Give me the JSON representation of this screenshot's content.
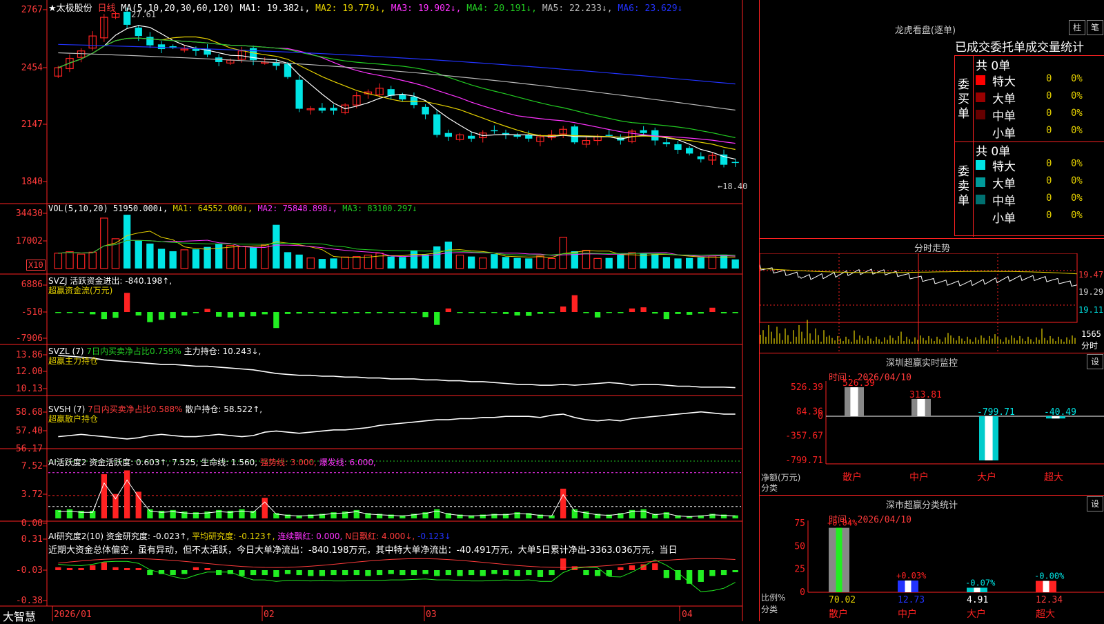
{
  "header": {
    "stock_name": "★太极股份",
    "period": "日线",
    "ma_label": "MA(5,10,20,30,60,120)",
    "ma1": "MA1: 19.382↓,",
    "ma2": "MA2: 19.779↓,",
    "ma3": "MA3: 19.902↓,",
    "ma4": "MA4: 20.191↓,",
    "ma5": "MA5: 22.233↓,",
    "ma6": "MA6: 23.629↓",
    "high_mark": "27.61",
    "low_mark": "←18.40"
  },
  "price_axis": [
    "2767",
    "2454",
    "2147",
    "1840"
  ],
  "vol": {
    "label": "VOL(5,10,20) 51950.000↓,",
    "ma1": "MA1: 64552.000↓,",
    "ma2": "MA2: 75848.898↓,",
    "ma3": "MA3: 83100.297↓",
    "axis": [
      "34430",
      "17002"
    ],
    "unit": "X10"
  },
  "svzj": {
    "label": "SVZJ  活跃资金进出: -840.198↑,",
    "sub": "超赢资金流(万元)",
    "axis": [
      "6886",
      "-510",
      "-7906"
    ]
  },
  "svzl": {
    "label": "SVZL (7)",
    "ratio": "7日内买卖净占比0.759%",
    "hold": "主力持仓: 10.243↓,",
    "sub": "超赢主力持仓",
    "axis": [
      "13.86",
      "12.00",
      "10.13"
    ]
  },
  "svsh": {
    "label": "SVSH (7)",
    "ratio": "7日内买卖净占比0.588%",
    "hold": "散户持仓: 58.522↑,",
    "sub": "超赢散户持仓",
    "axis": [
      "58.68",
      "57.40",
      "56.17"
    ]
  },
  "ai": {
    "label": "AI活跃度2 资金活跃度: 0.603↑, 7.525, 生命线: 1.560,",
    "strong": "强势线: 3.000,",
    "burst": "爆发线: 6.000,",
    "axis": [
      "7.52",
      "3.72",
      "0.00"
    ]
  },
  "research": {
    "label": "AI研究度2(10) 资金研究度: -0.023↑,",
    "avg": "平均研究度: -0.123↑,",
    "cont": "连续飘红: 0.000,",
    "nday": "N日飘红: 4.000↓,",
    "last": "-0.123↓",
    "summary": "近期大资金总体偏空，虽有异动，但不太活跃，今日大单净流出：-840.198万元，其中特大单净流出：-40.491万元，大单5日累计净出-3363.036万元，当日",
    "axis": [
      "0.31",
      "-0.03",
      "-0.38"
    ]
  },
  "xaxis": {
    "brand": "大智慧",
    "dates": [
      "2026/01",
      "02",
      "03",
      "04"
    ]
  },
  "dragon": {
    "title": "龙虎看盘(逐单)",
    "tab1": "柱",
    "tab2": "笔",
    "subtitle": "已成交委托单成交量统计",
    "buy_label": "委买单",
    "sell_label": "委卖单",
    "buy_total": "共 0单",
    "sell_total": "共 0单",
    "buy_rows": [
      {
        "name": "特大",
        "val": "0",
        "pct": "0%",
        "color": "#ff0000"
      },
      {
        "name": "大单",
        "val": "0",
        "pct": "0%",
        "color": "#990000"
      },
      {
        "name": "中单",
        "val": "0",
        "pct": "0%",
        "color": "#660000"
      },
      {
        "name": "小单",
        "val": "0",
        "pct": "0%",
        "color": ""
      }
    ],
    "sell_rows": [
      {
        "name": "特大",
        "val": "0",
        "pct": "0%",
        "color": "#00e5e5"
      },
      {
        "name": "大单",
        "val": "0",
        "pct": "0%",
        "color": "#009a9a"
      },
      {
        "name": "中单",
        "val": "0",
        "pct": "0%",
        "color": "#007070"
      },
      {
        "name": "小单",
        "val": "0",
        "pct": "0%",
        "color": ""
      }
    ]
  },
  "intraday": {
    "title": "分时走势",
    "axis": [
      "19.47",
      "19.29",
      "19.11"
    ],
    "vol": "1565",
    "vol_unit": "分时"
  },
  "monitor": {
    "title": "深圳超赢实时监控",
    "set": "设",
    "time": "时间: 2026/04/10",
    "axis": [
      "526.39",
      "84.36",
      "0",
      "-357.67",
      "-799.71"
    ],
    "ylabel": "净额(万元)",
    "xlabel": "分类",
    "bars": [
      {
        "name": "散户",
        "value": 526.39,
        "label": "526.39"
      },
      {
        "name": "中户",
        "value": 313.81,
        "label": "313.81"
      },
      {
        "name": "大户",
        "value": -799.71,
        "label": "-799.71"
      },
      {
        "name": "超大",
        "value": -40.49,
        "label": "-40.49"
      }
    ]
  },
  "stats": {
    "title": "深市超赢分类统计",
    "set": "设",
    "time": "时间: 2026/04/10",
    "axis": [
      "75",
      "50",
      "25",
      "0"
    ],
    "ylabel": "比例%",
    "xlabel": "分类",
    "bars": [
      {
        "name": "散户",
        "value": 70.02,
        "label": "70.02",
        "change": "+0.04%"
      },
      {
        "name": "中户",
        "value": 12.73,
        "label": "12.73",
        "change": "+0.03%"
      },
      {
        "name": "大户",
        "value": 4.91,
        "label": "4.91",
        "change": "-0.07%"
      },
      {
        "name": "超大",
        "value": 12.34,
        "label": "12.34",
        "change": "-0.00%"
      }
    ]
  },
  "chart_data": [
    {
      "type": "candlestick",
      "xlabel": "",
      "ylabel": "",
      "ylim": [
        18.4,
        27.61
      ],
      "x_ticks": [
        "2026/01",
        "02",
        "03",
        "04"
      ],
      "close": [
        24.5,
        25.0,
        25.4,
        26.2,
        27.2,
        27.4,
        26.8,
        26.2,
        25.7,
        25.5,
        25.6,
        25.5,
        25.4,
        25.2,
        24.8,
        24.9,
        25.4,
        24.9,
        24.8,
        24.6,
        24.0,
        22.3,
        22.3,
        22.2,
        22.2,
        22.5,
        23.0,
        23.2,
        23.4,
        23.0,
        22.8,
        22.5,
        22.0,
        20.9,
        20.8,
        20.9,
        20.7,
        21.0,
        21.1,
        20.9,
        20.8,
        20.7,
        20.8,
        20.9,
        21.2,
        20.5,
        20.6,
        20.8,
        20.9,
        20.6,
        21.1,
        21.0,
        20.6,
        20.4,
        20.1,
        19.9,
        19.6,
        19.8,
        19.3,
        19.4
      ],
      "ma_series": [
        {
          "name": "MA1",
          "color": "#ffffff"
        },
        {
          "name": "MA2",
          "color": "#e6d200"
        },
        {
          "name": "MA3",
          "color": "#ff33ff"
        },
        {
          "name": "MA4",
          "color": "#22cc22"
        },
        {
          "name": "MA5",
          "color": "#bbbbbb"
        },
        {
          "name": "MA6",
          "color": "#2233ff"
        }
      ]
    },
    {
      "type": "bar",
      "title": "VOL",
      "values": [
        3.2,
        3.5,
        3.0,
        3.4,
        10.5,
        6.2,
        11.2,
        5.8,
        5.2,
        4.1,
        3.6,
        3.9,
        4.0,
        4.5,
        5.1,
        4.8,
        4.6,
        4.4,
        4.9,
        9.1,
        3.4,
        2.9,
        2.2,
        2.0,
        2.1,
        2.4,
        2.5,
        2.8,
        3.2,
        2.5,
        2.4,
        3.8,
        2.9,
        4.6,
        5.6,
        2.8,
        2.5,
        2.2,
        3.0,
        2.4,
        2.2,
        2.1,
        2.6,
        2.1,
        6.5,
        3.6,
        3.8,
        2.1,
        2.2,
        2.9,
        3.3,
        3.2,
        3.0,
        2.4,
        2.1,
        2.2,
        2.3,
        2.6,
        2.9,
        1.9
      ]
    },
    {
      "type": "bar",
      "title": "超赢资金流",
      "values": [
        -200,
        -150,
        -250,
        -600,
        -1800,
        -1500,
        4900,
        -900,
        -2600,
        -2000,
        -1600,
        -900,
        -300,
        800,
        -1200,
        -1400,
        -1200,
        -1100,
        -600,
        -4100,
        -500,
        -400,
        -300,
        -200,
        -400,
        -300,
        -300,
        -350,
        -300,
        -250,
        -200,
        -150,
        -1300,
        -3300,
        900,
        -200,
        -200,
        -150,
        -200,
        -500,
        -900,
        -1000,
        -450,
        -300,
        1400,
        4300,
        -300,
        -1400,
        -200,
        -300,
        900,
        1200,
        -400,
        -1800,
        -500,
        -700,
        -400,
        1100,
        -350,
        -300
      ]
    },
    {
      "type": "line",
      "title": "超赢主力持仓",
      "values": [
        13.8,
        13.7,
        13.6,
        13.5,
        13.3,
        13.2,
        13.1,
        13.0,
        12.9,
        12.8,
        12.8,
        12.7,
        12.6,
        12.6,
        12.5,
        12.4,
        12.3,
        12.2,
        12.0,
        11.8,
        11.7,
        11.6,
        11.6,
        11.5,
        11.5,
        11.4,
        11.4,
        11.3,
        11.3,
        11.2,
        11.2,
        11.2,
        11.1,
        11.1,
        11.0,
        11.0,
        10.9,
        10.9,
        10.8,
        10.7,
        10.6,
        10.6,
        10.5,
        10.5,
        10.6,
        10.5,
        10.6,
        10.7,
        10.8,
        10.7,
        10.5,
        10.6,
        10.6,
        10.5,
        10.4,
        10.4,
        10.3,
        10.3,
        10.3,
        10.24
      ]
    },
    {
      "type": "line",
      "title": "超赢散户持仓",
      "values": [
        56.5,
        56.6,
        56.7,
        56.6,
        56.5,
        56.4,
        56.3,
        56.4,
        56.6,
        56.7,
        56.6,
        56.5,
        56.5,
        56.6,
        56.7,
        56.6,
        56.5,
        56.6,
        56.9,
        57.0,
        56.9,
        56.8,
        56.9,
        57.0,
        57.1,
        57.1,
        57.2,
        57.3,
        57.5,
        57.6,
        57.7,
        57.8,
        57.9,
        58.0,
        58.0,
        58.1,
        58.1,
        58.2,
        58.2,
        58.3,
        58.3,
        58.3,
        58.2,
        58.4,
        58.5,
        58.2,
        58.0,
        57.9,
        58.0,
        57.9,
        58.1,
        58.2,
        58.3,
        58.4,
        58.5,
        58.6,
        58.7,
        58.6,
        58.5,
        58.5
      ]
    },
    {
      "type": "bar",
      "title": "AI活跃度2",
      "values": [
        1.1,
        1.2,
        1.0,
        1.0,
        5.8,
        3.2,
        6.3,
        3.5,
        1.2,
        1.0,
        1.1,
        0.9,
        0.8,
        0.9,
        1.1,
        1.0,
        1.2,
        1.0,
        2.7,
        0.7,
        0.5,
        0.4,
        0.5,
        0.6,
        0.8,
        0.9,
        1.1,
        0.7,
        0.6,
        0.5,
        0.4,
        0.6,
        0.8,
        1.2,
        0.7,
        0.5,
        0.4,
        0.5,
        0.6,
        0.6,
        0.8,
        0.7,
        0.5,
        0.4,
        3.9,
        1.2,
        0.9,
        0.6,
        0.5,
        0.7,
        1.1,
        1.2,
        0.6,
        0.8,
        0.4,
        0.3,
        0.4,
        0.6,
        0.5,
        0.4
      ]
    },
    {
      "type": "bar",
      "title": "AI研究度2",
      "values": [
        0.03,
        0.02,
        0.02,
        0.05,
        0.08,
        0.03,
        0.02,
        0.01,
        -0.05,
        -0.04,
        -0.05,
        -0.04,
        0.03,
        0.02,
        -0.05,
        -0.04,
        -0.06,
        -0.05,
        -0.05,
        -0.07,
        -0.04,
        -0.05,
        -0.06,
        -0.06,
        -0.05,
        -0.05,
        -0.05,
        -0.06,
        -0.05,
        -0.04,
        -0.05,
        -0.05,
        -0.04,
        -0.06,
        -0.05,
        -0.06,
        -0.05,
        -0.06,
        -0.04,
        -0.05,
        -0.06,
        -0.05,
        -0.07,
        -0.05,
        0.12,
        0.04,
        -0.05,
        -0.06,
        -0.06,
        0.03,
        0.05,
        0.06,
        0.07,
        -0.08,
        -0.1,
        -0.14,
        -0.12,
        -0.06,
        -0.05,
        -0.02
      ]
    }
  ]
}
